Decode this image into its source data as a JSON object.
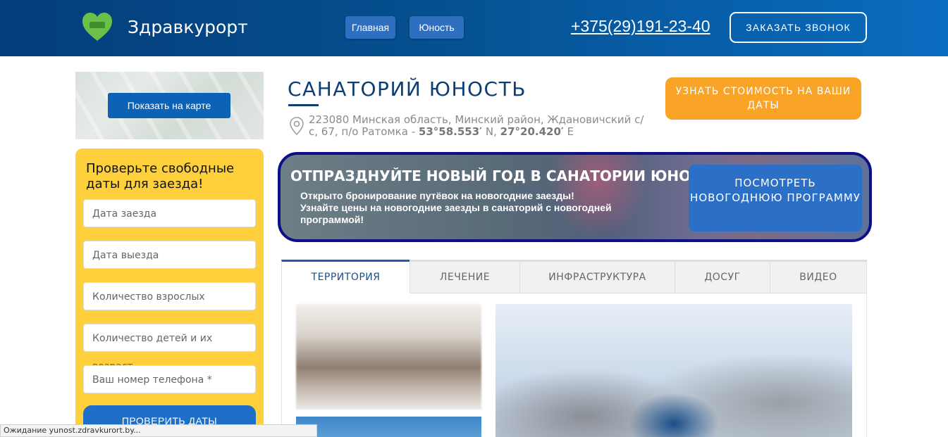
{
  "header": {
    "logo_text": "Здравкурорт",
    "nav": [
      {
        "label": "Главная"
      },
      {
        "label": "Юность"
      }
    ],
    "phone": "+375(29)191-23-40",
    "call_button": "ЗАКАЗАТЬ ЗВОНОК"
  },
  "map": {
    "button": "Показать на карте"
  },
  "form": {
    "title": "Проверьте свободные даты для заезда!",
    "fields": [
      {
        "placeholder": "Дата заезда"
      },
      {
        "placeholder": "Дата выезда"
      },
      {
        "placeholder": "Количество взрослых"
      },
      {
        "placeholder": "Количество детей и их возраст"
      },
      {
        "placeholder": "Ваш номер телефона *"
      }
    ],
    "submit": "ПРОВЕРИТЬ ДАТЫ"
  },
  "main": {
    "title": "САНАТОРИЙ ЮНОСТЬ",
    "address_text": "223080 Минская область, Минский район, Ждановичский с/с, 67, п/о Ратомка - ",
    "lat": "53°58.553′",
    "lat_dir": " N, ",
    "lon": "27°20.420′",
    "lon_dir": " E",
    "price_button": "УЗНАТЬ СТОИМОСТЬ НА ВАШИ ДАТЫ"
  },
  "banner": {
    "title": "ОТПРАЗДНУЙТЕ НОВЫЙ ГОД В САНАТОРИИ ЮНОСТЬ",
    "line1": "Открыто бронирование путёвок на новогодние заезды!",
    "line2": "Узнайте цены на новогодние заезды в санаторий с новогодней программой!",
    "button": "ПОСМОТРЕТЬ НОВОГОДНЮЮ ПРОГРАММУ"
  },
  "tabs": [
    {
      "label": "ТЕРРИТОРИЯ"
    },
    {
      "label": "ЛЕЧЕНИЕ"
    },
    {
      "label": "ИНФРАСТРУКТУРА"
    },
    {
      "label": "ДОСУГ"
    },
    {
      "label": "ВИДЕО"
    }
  ],
  "status_bar": "Ожидание yunost.zdravkurort.by...",
  "colors": {
    "header_blue": "#05508f",
    "accent_orange": "#f9a427",
    "form_yellow": "#fdd03c",
    "banner_border": "#0d0e8a",
    "title_blue": "#0d3e74"
  },
  "icons": [
    "heart-logo-icon",
    "map-pin-icon"
  ]
}
